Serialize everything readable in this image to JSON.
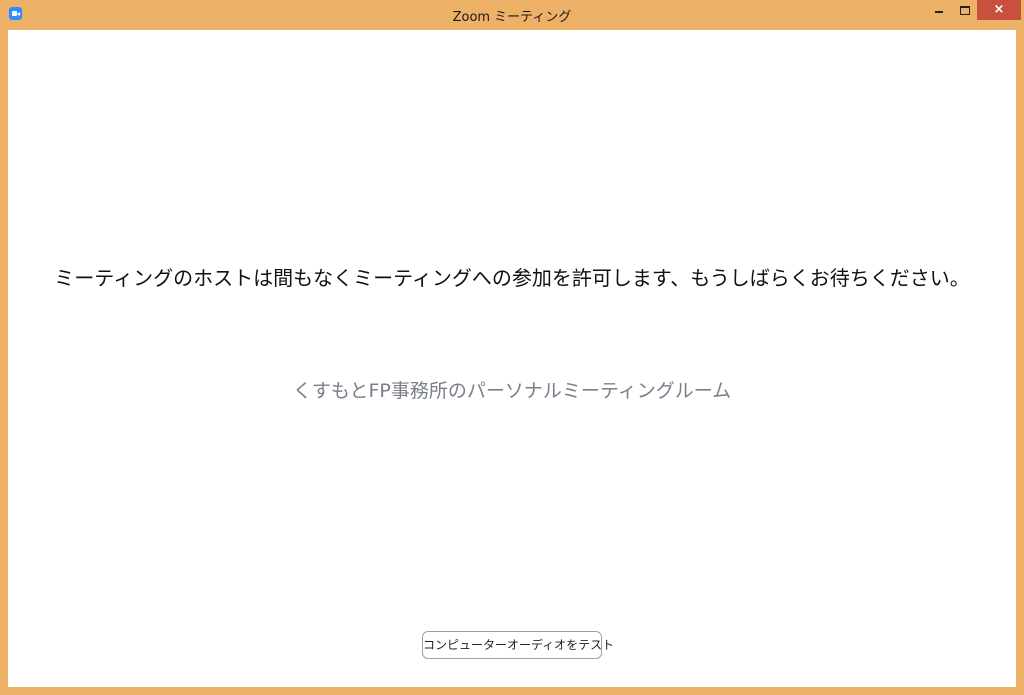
{
  "window": {
    "title": "Zoom ミーティング",
    "frame_color": "#ecb167",
    "close_color": "#c7503f",
    "controls": {
      "minimize_icon": "minimize-icon",
      "maximize_icon": "maximize-icon",
      "close_label": "×"
    }
  },
  "main": {
    "message": "ミーティングのホストは間もなくミーティングへの参加を許可します、もうしばらくお待ちください。",
    "room_name": "くすもとFP事務所のパーソナルミーティングルーム",
    "test_audio_label": "コンピューターオーディオをテスト"
  }
}
